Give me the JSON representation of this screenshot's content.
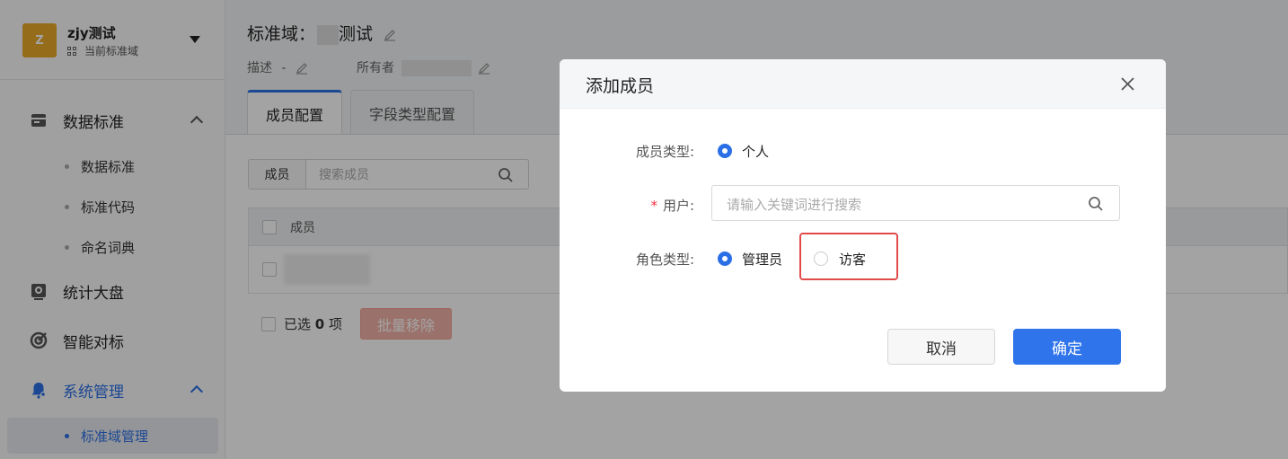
{
  "sidebar": {
    "domain": {
      "logo_letter": "Z",
      "name": "zjy测试",
      "subtitle": "当前标准域"
    },
    "groups": [
      {
        "label": "数据标准",
        "expanded": true,
        "items": [
          "数据标准",
          "标准代码",
          "命名词典"
        ]
      },
      {
        "label": "统计大盘"
      },
      {
        "label": "智能对标"
      },
      {
        "label": "系统管理",
        "expanded": true,
        "items": [
          "标准域管理"
        ]
      }
    ]
  },
  "header": {
    "title_prefix": "标准域：",
    "title_suffix": "测试",
    "desc_label": "描述",
    "desc_value": "-",
    "owner_label": "所有者"
  },
  "tabs": [
    "成员配置",
    "字段类型配置"
  ],
  "members": {
    "search_prefix": "成员",
    "search_placeholder": "搜索成员",
    "table_header": "成员",
    "footer_selected_prefix": "已选",
    "footer_selected_count": "0",
    "footer_selected_suffix": "项",
    "bulk_remove": "批量移除"
  },
  "modal": {
    "title": "添加成员",
    "member_type_label": "成员类型:",
    "member_type_value": "个人",
    "user_label": "用户:",
    "user_placeholder": "请输入关键词进行搜索",
    "role_label": "角色类型:",
    "role_options": [
      "管理员",
      "访客"
    ],
    "role_selected": "管理员",
    "cancel": "取消",
    "confirm": "确定"
  },
  "colors": {
    "primary": "#2b6fe6",
    "danger_highlight": "#e24a4a",
    "logo": "#e9a928"
  }
}
